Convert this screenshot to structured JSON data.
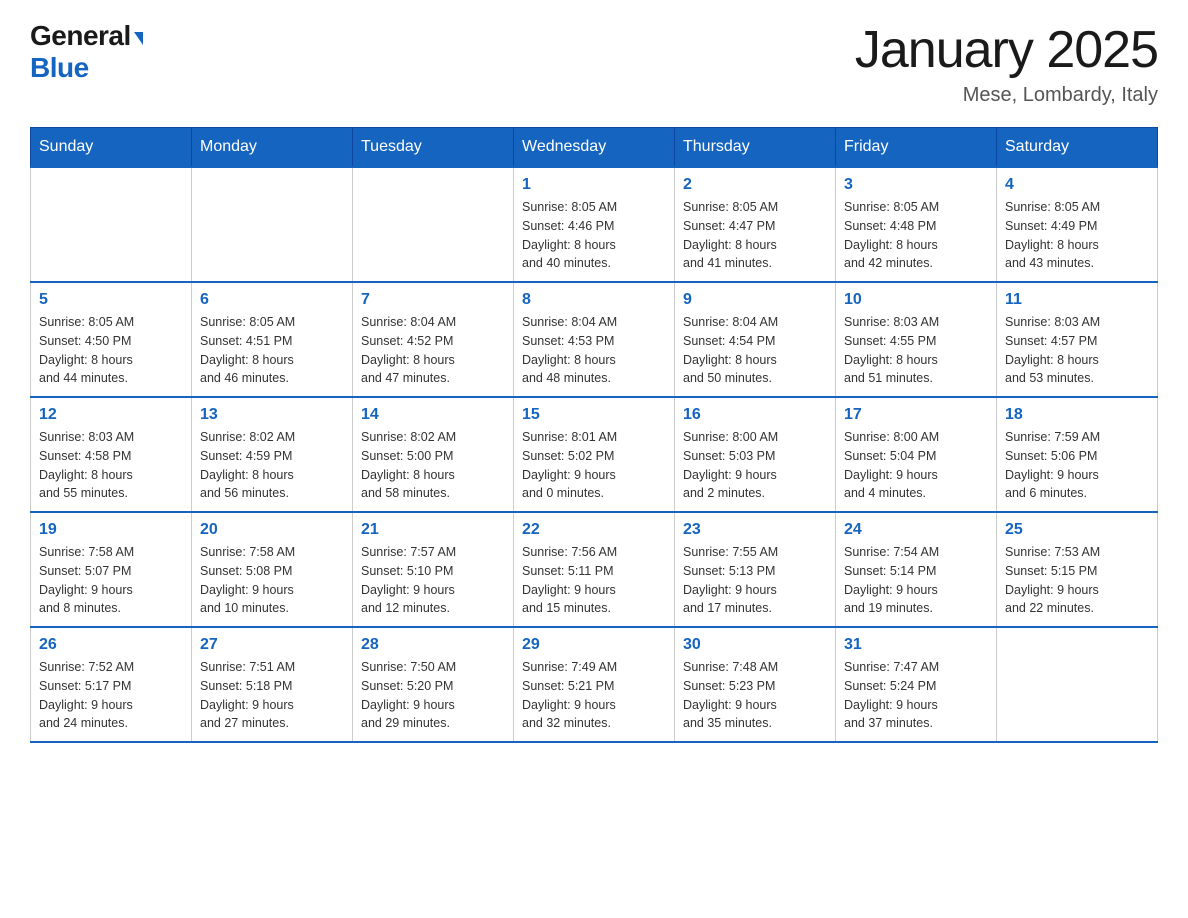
{
  "header": {
    "logo_general": "General",
    "logo_blue": "Blue",
    "month_title": "January 2025",
    "location": "Mese, Lombardy, Italy"
  },
  "weekdays": [
    "Sunday",
    "Monday",
    "Tuesday",
    "Wednesday",
    "Thursday",
    "Friday",
    "Saturday"
  ],
  "weeks": [
    [
      {
        "day": "",
        "info": ""
      },
      {
        "day": "",
        "info": ""
      },
      {
        "day": "",
        "info": ""
      },
      {
        "day": "1",
        "info": "Sunrise: 8:05 AM\nSunset: 4:46 PM\nDaylight: 8 hours\nand 40 minutes."
      },
      {
        "day": "2",
        "info": "Sunrise: 8:05 AM\nSunset: 4:47 PM\nDaylight: 8 hours\nand 41 minutes."
      },
      {
        "day": "3",
        "info": "Sunrise: 8:05 AM\nSunset: 4:48 PM\nDaylight: 8 hours\nand 42 minutes."
      },
      {
        "day": "4",
        "info": "Sunrise: 8:05 AM\nSunset: 4:49 PM\nDaylight: 8 hours\nand 43 minutes."
      }
    ],
    [
      {
        "day": "5",
        "info": "Sunrise: 8:05 AM\nSunset: 4:50 PM\nDaylight: 8 hours\nand 44 minutes."
      },
      {
        "day": "6",
        "info": "Sunrise: 8:05 AM\nSunset: 4:51 PM\nDaylight: 8 hours\nand 46 minutes."
      },
      {
        "day": "7",
        "info": "Sunrise: 8:04 AM\nSunset: 4:52 PM\nDaylight: 8 hours\nand 47 minutes."
      },
      {
        "day": "8",
        "info": "Sunrise: 8:04 AM\nSunset: 4:53 PM\nDaylight: 8 hours\nand 48 minutes."
      },
      {
        "day": "9",
        "info": "Sunrise: 8:04 AM\nSunset: 4:54 PM\nDaylight: 8 hours\nand 50 minutes."
      },
      {
        "day": "10",
        "info": "Sunrise: 8:03 AM\nSunset: 4:55 PM\nDaylight: 8 hours\nand 51 minutes."
      },
      {
        "day": "11",
        "info": "Sunrise: 8:03 AM\nSunset: 4:57 PM\nDaylight: 8 hours\nand 53 minutes."
      }
    ],
    [
      {
        "day": "12",
        "info": "Sunrise: 8:03 AM\nSunset: 4:58 PM\nDaylight: 8 hours\nand 55 minutes."
      },
      {
        "day": "13",
        "info": "Sunrise: 8:02 AM\nSunset: 4:59 PM\nDaylight: 8 hours\nand 56 minutes."
      },
      {
        "day": "14",
        "info": "Sunrise: 8:02 AM\nSunset: 5:00 PM\nDaylight: 8 hours\nand 58 minutes."
      },
      {
        "day": "15",
        "info": "Sunrise: 8:01 AM\nSunset: 5:02 PM\nDaylight: 9 hours\nand 0 minutes."
      },
      {
        "day": "16",
        "info": "Sunrise: 8:00 AM\nSunset: 5:03 PM\nDaylight: 9 hours\nand 2 minutes."
      },
      {
        "day": "17",
        "info": "Sunrise: 8:00 AM\nSunset: 5:04 PM\nDaylight: 9 hours\nand 4 minutes."
      },
      {
        "day": "18",
        "info": "Sunrise: 7:59 AM\nSunset: 5:06 PM\nDaylight: 9 hours\nand 6 minutes."
      }
    ],
    [
      {
        "day": "19",
        "info": "Sunrise: 7:58 AM\nSunset: 5:07 PM\nDaylight: 9 hours\nand 8 minutes."
      },
      {
        "day": "20",
        "info": "Sunrise: 7:58 AM\nSunset: 5:08 PM\nDaylight: 9 hours\nand 10 minutes."
      },
      {
        "day": "21",
        "info": "Sunrise: 7:57 AM\nSunset: 5:10 PM\nDaylight: 9 hours\nand 12 minutes."
      },
      {
        "day": "22",
        "info": "Sunrise: 7:56 AM\nSunset: 5:11 PM\nDaylight: 9 hours\nand 15 minutes."
      },
      {
        "day": "23",
        "info": "Sunrise: 7:55 AM\nSunset: 5:13 PM\nDaylight: 9 hours\nand 17 minutes."
      },
      {
        "day": "24",
        "info": "Sunrise: 7:54 AM\nSunset: 5:14 PM\nDaylight: 9 hours\nand 19 minutes."
      },
      {
        "day": "25",
        "info": "Sunrise: 7:53 AM\nSunset: 5:15 PM\nDaylight: 9 hours\nand 22 minutes."
      }
    ],
    [
      {
        "day": "26",
        "info": "Sunrise: 7:52 AM\nSunset: 5:17 PM\nDaylight: 9 hours\nand 24 minutes."
      },
      {
        "day": "27",
        "info": "Sunrise: 7:51 AM\nSunset: 5:18 PM\nDaylight: 9 hours\nand 27 minutes."
      },
      {
        "day": "28",
        "info": "Sunrise: 7:50 AM\nSunset: 5:20 PM\nDaylight: 9 hours\nand 29 minutes."
      },
      {
        "day": "29",
        "info": "Sunrise: 7:49 AM\nSunset: 5:21 PM\nDaylight: 9 hours\nand 32 minutes."
      },
      {
        "day": "30",
        "info": "Sunrise: 7:48 AM\nSunset: 5:23 PM\nDaylight: 9 hours\nand 35 minutes."
      },
      {
        "day": "31",
        "info": "Sunrise: 7:47 AM\nSunset: 5:24 PM\nDaylight: 9 hours\nand 37 minutes."
      },
      {
        "day": "",
        "info": ""
      }
    ]
  ]
}
